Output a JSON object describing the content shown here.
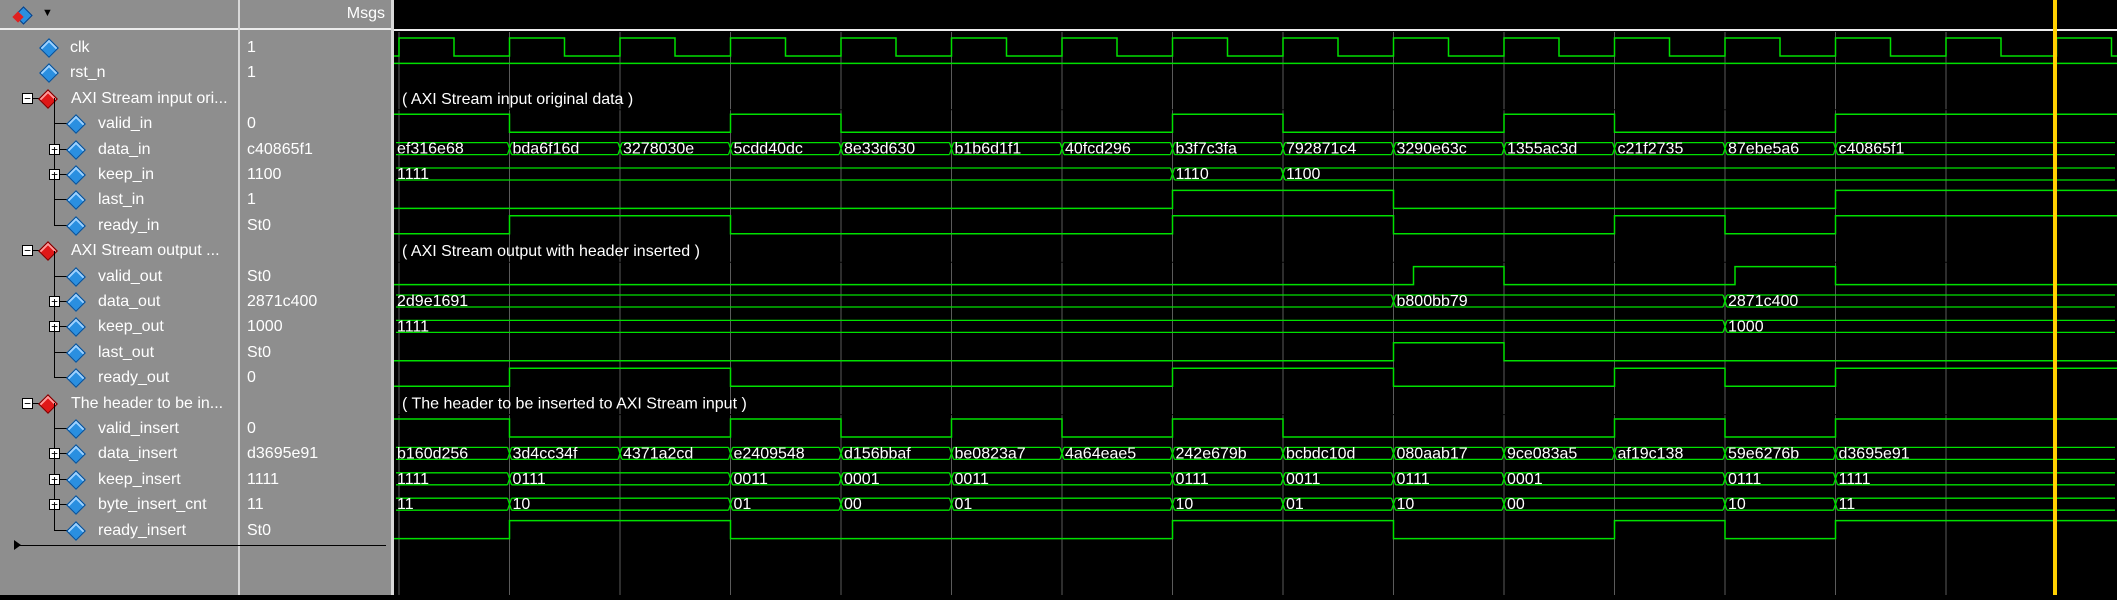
{
  "toolbar": {
    "icon": "wave-tool-icon"
  },
  "header": {
    "msgs_label": "Msgs"
  },
  "signals": [
    {
      "name": "clk",
      "value": "1",
      "level": 1,
      "kind": "signal",
      "expand": false
    },
    {
      "name": "rst_n",
      "value": "1",
      "level": 1,
      "kind": "signal",
      "expand": false
    },
    {
      "name": "AXI Stream input ori...",
      "value": "",
      "level": 0,
      "kind": "group",
      "expand": true
    },
    {
      "name": "valid_in",
      "value": "0",
      "level": 2,
      "kind": "signal",
      "expand": false
    },
    {
      "name": "data_in",
      "value": "c40865f1",
      "level": 2,
      "kind": "bus",
      "expand": true
    },
    {
      "name": "keep_in",
      "value": "1100",
      "level": 2,
      "kind": "bus",
      "expand": true
    },
    {
      "name": "last_in",
      "value": "1",
      "level": 2,
      "kind": "signal",
      "expand": false
    },
    {
      "name": "ready_in",
      "value": "St0",
      "level": 2,
      "kind": "signal",
      "expand": false
    },
    {
      "name": "AXI Stream output ...",
      "value": "",
      "level": 0,
      "kind": "group",
      "expand": true
    },
    {
      "name": "valid_out",
      "value": "St0",
      "level": 2,
      "kind": "signal",
      "expand": false
    },
    {
      "name": "data_out",
      "value": "2871c400",
      "level": 2,
      "kind": "bus",
      "expand": true
    },
    {
      "name": "keep_out",
      "value": "1000",
      "level": 2,
      "kind": "bus",
      "expand": true
    },
    {
      "name": "last_out",
      "value": "St0",
      "level": 2,
      "kind": "signal",
      "expand": false
    },
    {
      "name": "ready_out",
      "value": "0",
      "level": 2,
      "kind": "signal",
      "expand": false
    },
    {
      "name": "The header to be in...",
      "value": "",
      "level": 0,
      "kind": "group",
      "expand": true
    },
    {
      "name": "valid_insert",
      "value": "0",
      "level": 2,
      "kind": "signal",
      "expand": false
    },
    {
      "name": "data_insert",
      "value": "d3695e91",
      "level": 2,
      "kind": "bus",
      "expand": true
    },
    {
      "name": "keep_insert",
      "value": "1111",
      "level": 2,
      "kind": "bus",
      "expand": true
    },
    {
      "name": "byte_insert_cnt",
      "value": "11",
      "level": 2,
      "kind": "bus",
      "expand": true
    },
    {
      "name": "ready_insert",
      "value": "St0",
      "level": 2,
      "kind": "signal",
      "expand": false
    }
  ],
  "group_labels": [
    "( AXI Stream input original data )",
    "( AXI Stream output with header inserted )",
    "( The header to be inserted to AXI Stream input )"
  ],
  "bus_values": {
    "data_in": [
      "ef316e68",
      "bda6f16d",
      "3278030e",
      "5cdd40dc",
      "8e33d630",
      "b1b6d1f1",
      "40fcd296",
      "b3f7c3fa",
      "792871c4",
      "3290e63c",
      "1355ac3d",
      "c21f2735",
      "87ebe5a6",
      "c40865f1"
    ],
    "keep_in": [
      "1111",
      "1110",
      "1100"
    ],
    "data_out": [
      "2d9e1691",
      "b800bb79",
      "2871c400"
    ],
    "keep_out": [
      "1111",
      "1000"
    ],
    "data_insert": [
      "b160d256",
      "3d4cc34f",
      "4371a2cd",
      "e2409548",
      "d156bbaf",
      "be0823a7",
      "4a64eae5",
      "242e679b",
      "bcbdc10d",
      "080aab17",
      "9ce083a5",
      "af19c138",
      "59e6276b",
      "d3695e91"
    ],
    "keep_insert": [
      "1111",
      "0111",
      "0011",
      "0001",
      "0011",
      "0111",
      "0011",
      "0111",
      "0001",
      "0111",
      "1111"
    ],
    "byte_insert_cnt": [
      "11",
      "10",
      "01",
      "00",
      "01",
      "10",
      "01",
      "10",
      "00",
      "10",
      "11"
    ]
  },
  "colors": {
    "wave": "#00e000",
    "cursor": "#ffd000",
    "grid": "#5a5a5a",
    "panel": "#8e8e8e"
  }
}
